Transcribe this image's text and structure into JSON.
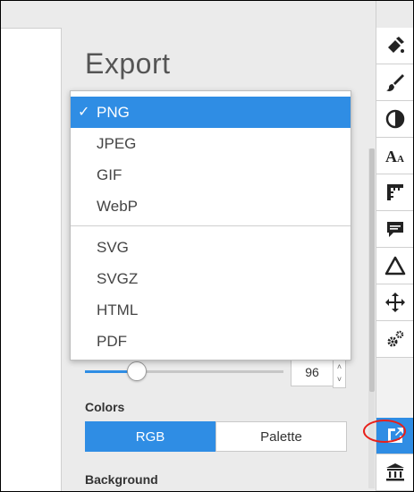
{
  "panel": {
    "title": "Export"
  },
  "format_menu": {
    "selected": "PNG",
    "items": [
      "PNG",
      "JPEG",
      "GIF",
      "WebP",
      "SVG",
      "SVGZ",
      "HTML",
      "PDF"
    ],
    "checkmark": "✓"
  },
  "quality": {
    "value": "96",
    "level_percent": 96
  },
  "colors": {
    "label": "Colors",
    "options": [
      "RGB",
      "Palette"
    ],
    "selected": "RGB"
  },
  "background": {
    "label": "Background"
  },
  "toolbar": {
    "tools": [
      "fill-icon",
      "brush-icon",
      "contrast-icon",
      "text-size-icon",
      "ruler-icon",
      "comment-icon",
      "triangle-icon",
      "move-icon",
      "settings-icon",
      "export-icon",
      "institution-icon"
    ],
    "active": "export-icon"
  },
  "accent_color": "#2f8de4"
}
